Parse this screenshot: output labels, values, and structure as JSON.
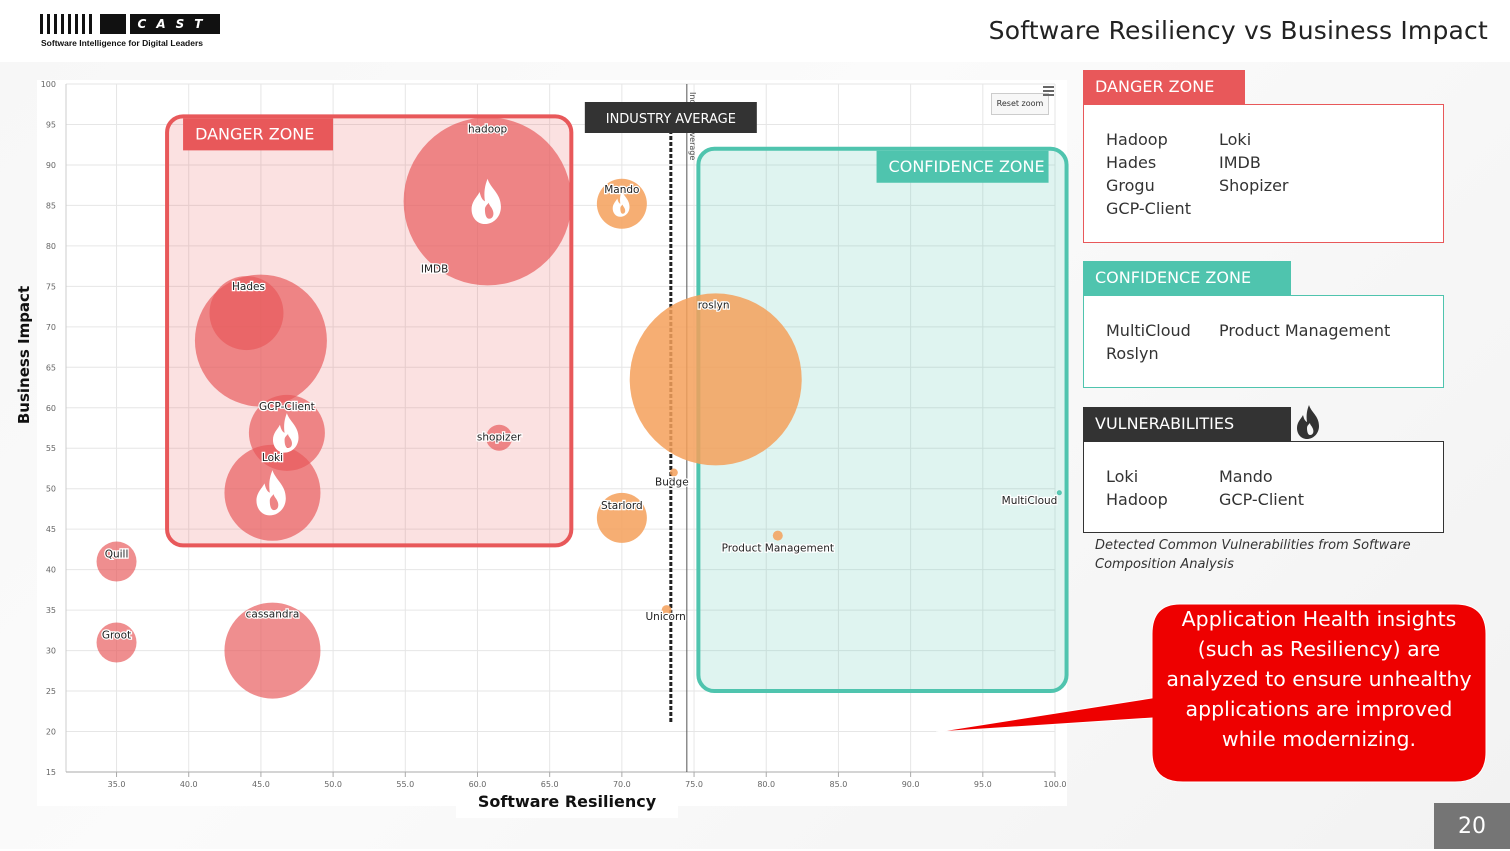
{
  "header": {
    "logo_text": "CAST",
    "logo_tagline": "Software Intelligence for Digital Leaders",
    "title": "Software Resiliency vs Business Impact"
  },
  "chart_data": {
    "type": "bubble",
    "xlabel": "Software Resiliency",
    "ylabel": "Business Impact",
    "xlim": [
      31.5,
      100
    ],
    "ylim": [
      15,
      100
    ],
    "x_ticks": [
      "35.0",
      "40.0",
      "45.0",
      "50.0",
      "55.0",
      "60.0",
      "65.0",
      "70.0",
      "75.0",
      "80.0",
      "85.0",
      "90.0",
      "95.0",
      "100.0"
    ],
    "y_ticks": [
      "15",
      "20",
      "25",
      "30",
      "35",
      "40",
      "45",
      "50",
      "55",
      "60",
      "65",
      "70",
      "75",
      "80",
      "85",
      "90",
      "95",
      "100"
    ],
    "industry_average_line": 74.5,
    "industry_average_label": "INDUSTRY AVERAGE",
    "industry_average_axis_label": "Industry Average",
    "reset_zoom_label": "Reset zoom",
    "zones": [
      {
        "name": "DANGER ZONE",
        "x_range": [
          38.5,
          66.5
        ],
        "y_range": [
          43,
          96
        ],
        "color": "#e8585a"
      },
      {
        "name": "CONFIDENCE ZONE",
        "x_range": [
          75.3,
          100.8
        ],
        "y_range": [
          25,
          92
        ],
        "color": "#4fc4ae"
      }
    ],
    "points": [
      {
        "name": "hadoop",
        "x": 60.7,
        "y": 85.5,
        "size": 84,
        "color": "#e8585a",
        "vulnerable": true
      },
      {
        "name": "IMDB",
        "x": 60.7,
        "y": 85.5,
        "size": 0,
        "color": "#e8585a",
        "vulnerable": false
      },
      {
        "name": "Hades",
        "x": 44.0,
        "y": 71.7,
        "size": 37,
        "color": "#e8585a",
        "vulnerable": false
      },
      {
        "name": "Grogu",
        "x": 45.0,
        "y": 68.3,
        "size": 66,
        "color": "#e8585a",
        "vulnerable": false
      },
      {
        "name": "GCP-Client",
        "x": 46.8,
        "y": 56.9,
        "size": 38,
        "color": "#e8585a",
        "vulnerable": true
      },
      {
        "name": "Loki",
        "x": 45.8,
        "y": 49.5,
        "size": 48,
        "color": "#e8585a",
        "vulnerable": true
      },
      {
        "name": "shopizer",
        "x": 61.5,
        "y": 56.3,
        "size": 13,
        "color": "#e8585a",
        "vulnerable": false
      },
      {
        "name": "Quill",
        "x": 35.0,
        "y": 41.0,
        "size": 20,
        "color": "#e8585a",
        "vulnerable": false
      },
      {
        "name": "Groot",
        "x": 35.0,
        "y": 31.0,
        "size": 20,
        "color": "#e8585a",
        "vulnerable": false
      },
      {
        "name": "cassandra",
        "x": 45.8,
        "y": 30.0,
        "size": 48,
        "color": "#e8585a",
        "vulnerable": false
      },
      {
        "name": "Mando",
        "x": 70.0,
        "y": 85.2,
        "size": 25,
        "color": "#f5a05a",
        "vulnerable": true
      },
      {
        "name": "roslyn",
        "x": 76.5,
        "y": 63.5,
        "size": 86,
        "color": "#f5a05a",
        "vulnerable": false
      },
      {
        "name": "Budge",
        "x": 73.6,
        "y": 52.0,
        "size": 4,
        "color": "#f5a05a",
        "vulnerable": false
      },
      {
        "name": "Starlord",
        "x": 70.0,
        "y": 46.4,
        "size": 25,
        "color": "#f5a05a",
        "vulnerable": false
      },
      {
        "name": "Unicorn",
        "x": 73.1,
        "y": 35.0,
        "size": 5,
        "color": "#f5a05a",
        "vulnerable": false
      },
      {
        "name": "Product Management",
        "x": 80.8,
        "y": 44.2,
        "size": 5,
        "color": "#f5a05a",
        "vulnerable": false
      },
      {
        "name": "MultiCloud",
        "x": 100.3,
        "y": 49.5,
        "size": 2,
        "color": "#4fc4ae",
        "vulnerable": false
      }
    ]
  },
  "legend": {
    "danger": {
      "title": "DANGER ZONE",
      "col1": [
        "Hadoop",
        "Hades",
        "Grogu",
        "GCP-Client"
      ],
      "col2": [
        "Loki",
        "IMDB",
        "Shopizer"
      ]
    },
    "confidence": {
      "title": "CONFIDENCE ZONE",
      "col1": [
        "MultiCloud",
        "Roslyn"
      ],
      "col2": [
        "Product Management"
      ]
    },
    "vulnerabilities": {
      "title": "VULNERABILITIES",
      "col1": [
        "Loki",
        "Hadoop"
      ],
      "col2": [
        "Mando",
        "GCP-Client"
      ]
    },
    "note": "Detected Common Vulnerabilities from Software Composition Analysis"
  },
  "callout": {
    "text": "Application Health insights (such as Resiliency) are analyzed to ensure unhealthy applications are improved while modernizing.",
    "color": "#ee0000"
  },
  "page_number": "20",
  "colors": {
    "danger": "#e8585a",
    "confidence": "#4fc4ae",
    "dark": "#333333",
    "orange": "#f5a05a"
  }
}
